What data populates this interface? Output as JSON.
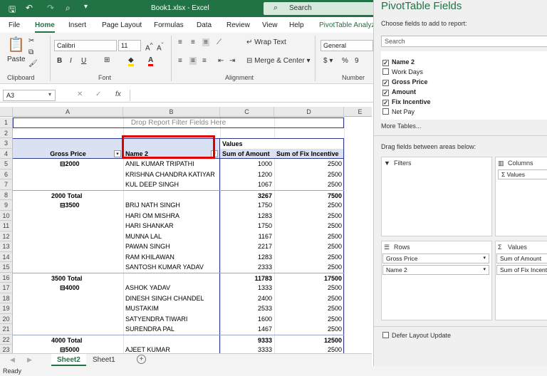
{
  "title_bar": {
    "doc_title": "Book1.xlsx  -  Excel",
    "search_label": "Search"
  },
  "menu": [
    "File",
    "Home",
    "Insert",
    "Page Layout",
    "Formulas",
    "Data",
    "Review",
    "View",
    "Help",
    "PivotTable Analyze"
  ],
  "ribbon": {
    "paste": "Paste",
    "font_name": "Calibri",
    "font_size": "11",
    "wrap_text": "Wrap Text",
    "merge_center": "Merge & Center",
    "number_format": "General",
    "groups": [
      "Clipboard",
      "Font",
      "Alignment",
      "Number"
    ]
  },
  "formula_bar": {
    "cell_ref": "A3",
    "fx": "fx"
  },
  "columns": [
    "A",
    "B",
    "C",
    "D",
    "E"
  ],
  "pivot": {
    "filter_hint": "Drop Report Filter Fields Here",
    "values_label": "Values",
    "headers": [
      "Gross Price",
      "Name 2",
      "Sum of Amount",
      "Sum of Fix Incentive"
    ],
    "rows": [
      {
        "n": "5",
        "a": "⊟2000",
        "b": "ANIL KUMAR TRIPATHI",
        "c": "1000",
        "d": "2500"
      },
      {
        "n": "6",
        "a": "",
        "b": "KRISHNA CHANDRA KATIYAR",
        "c": "1200",
        "d": "2500"
      },
      {
        "n": "7",
        "a": "",
        "b": "KUL DEEP SINGH",
        "c": "1067",
        "d": "2500"
      },
      {
        "n": "8",
        "a": "2000 Total",
        "b": "",
        "c": "3267",
        "d": "7500",
        "total": true
      },
      {
        "n": "9",
        "a": "⊟3500",
        "b": "BRIJ NATH SINGH",
        "c": "1750",
        "d": "2500"
      },
      {
        "n": "10",
        "a": "",
        "b": "HARI OM MISHRA",
        "c": "1283",
        "d": "2500"
      },
      {
        "n": "11",
        "a": "",
        "b": "HARI SHANKAR",
        "c": "1750",
        "d": "2500"
      },
      {
        "n": "12",
        "a": "",
        "b": "MUNNA LAL",
        "c": "1167",
        "d": "2500"
      },
      {
        "n": "13",
        "a": "",
        "b": "PAWAN SINGH",
        "c": "2217",
        "d": "2500"
      },
      {
        "n": "14",
        "a": "",
        "b": "RAM KHILAWAN",
        "c": "1283",
        "d": "2500"
      },
      {
        "n": "15",
        "a": "",
        "b": "SANTOSH KUMAR YADAV",
        "c": "2333",
        "d": "2500"
      },
      {
        "n": "16",
        "a": "3500 Total",
        "b": "",
        "c": "11783",
        "d": "17500",
        "total": true
      },
      {
        "n": "17",
        "a": "⊟4000",
        "b": "ASHOK YADAV",
        "c": "1333",
        "d": "2500"
      },
      {
        "n": "18",
        "a": "",
        "b": "DINESH SINGH CHANDEL",
        "c": "2400",
        "d": "2500"
      },
      {
        "n": "19",
        "a": "",
        "b": "MUSTAKIM",
        "c": "2533",
        "d": "2500"
      },
      {
        "n": "20",
        "a": "",
        "b": "SATYENDRA TIWARI",
        "c": "1600",
        "d": "2500"
      },
      {
        "n": "21",
        "a": "",
        "b": "SURENDRA PAL",
        "c": "1467",
        "d": "2500"
      },
      {
        "n": "22",
        "a": "4000 Total",
        "b": "",
        "c": "9333",
        "d": "12500",
        "total": true
      },
      {
        "n": "23",
        "a": "⊟5000",
        "b": "AJEET KUMAR",
        "c": "3333",
        "d": "2500"
      }
    ]
  },
  "sheet_tabs": [
    "Sheet2",
    "Sheet1"
  ],
  "status": "Ready",
  "pivot_pane": {
    "title": "PivotTable Fields",
    "subtitle": "Choose fields to add to report:",
    "search_placeholder": "Search",
    "fields": [
      {
        "label": "Name 2",
        "checked": true
      },
      {
        "label": "Work Days",
        "checked": false
      },
      {
        "label": "Gross Price",
        "checked": true
      },
      {
        "label": "Amount",
        "checked": true
      },
      {
        "label": "Fix Incentive",
        "checked": true
      },
      {
        "label": "Net Pay",
        "checked": false
      }
    ],
    "more_tables": "More Tables...",
    "drag_hint": "Drag fields between areas below:",
    "filters_label": "Filters",
    "columns_label": "Columns",
    "columns_items": [
      "Σ Values"
    ],
    "rows_label": "Rows",
    "rows_items": [
      "Gross Price",
      "Name 2"
    ],
    "values_label": "Values",
    "values_items": [
      "Sum of Amount",
      "Sum of Fix Incentive"
    ],
    "defer_label": "Defer Layout Update"
  },
  "colors": {
    "excel_green": "#217346",
    "pivot_header": "#d9e1f2",
    "highlight": "#e00000"
  }
}
